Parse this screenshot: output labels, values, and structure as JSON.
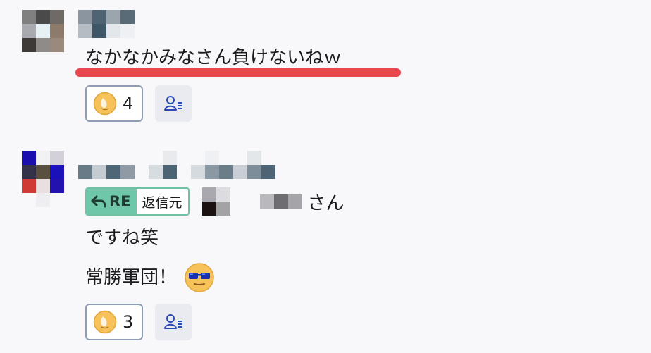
{
  "messages": [
    {
      "text": "なかなかみなさん負けないねｗ",
      "reactions": {
        "count": "4",
        "emoji": "sweat-smile-emoji"
      },
      "reactors_icon": "users-list-icon"
    },
    {
      "reply_badge": {
        "re_label": "RE",
        "source_label": "返信元"
      },
      "reply_suffix": "さん",
      "line1": "ですね笑",
      "line2": "常勝軍団！",
      "inline_emoji": "sunglasses-emoji",
      "reactions": {
        "count": "3",
        "emoji": "sweat-smile-emoji"
      },
      "reactors_icon": "users-list-icon"
    }
  ],
  "colors": {
    "highlight_underline": "#e5484d",
    "reply_badge_green": "#6fc7a9",
    "pill_border": "#8d9db3"
  }
}
